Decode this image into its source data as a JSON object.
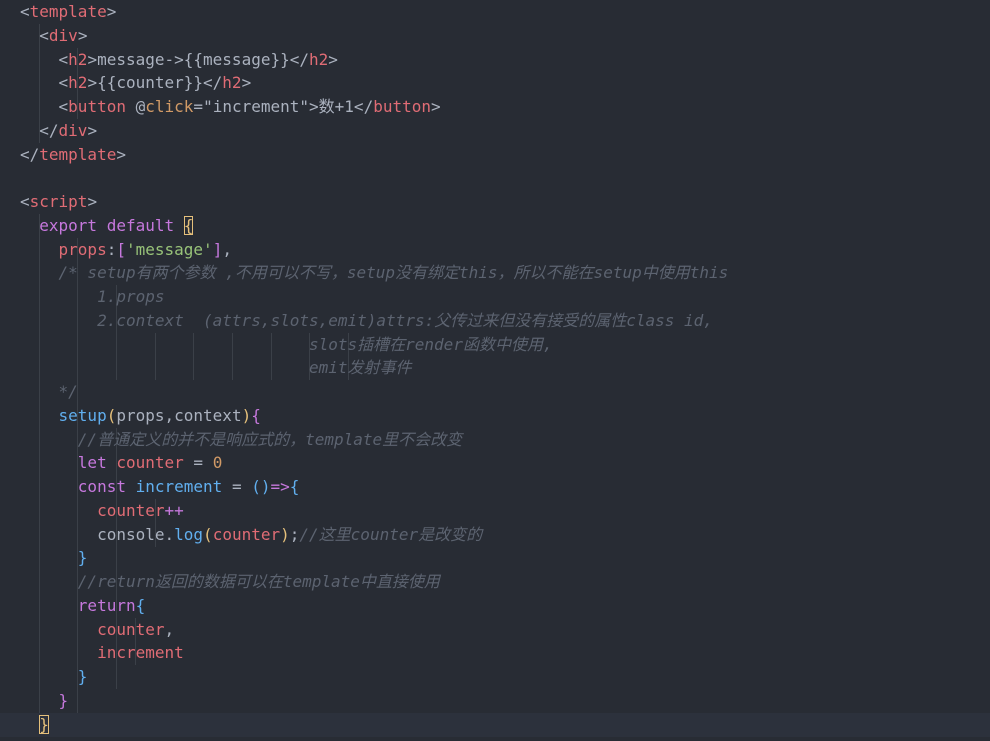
{
  "lines": [
    "<template>",
    "  <div>",
    "    <h2>message->{{message}}</h2>",
    "    <h2>{{counter}}</h2>",
    "    <button @click=\"increment\">数+1</button>",
    "  </div>",
    "</template>",
    "",
    "<script>",
    "  export default {",
    "    props:['message'],",
    "    /* setup有两个参数 ,不用可以不写，setup没有绑定this，所以不能在setup中使用this",
    "        1.props",
    "        2.context  (attrs,slots,emit)attrs:父传过来但没有接受的属性class id,",
    "                              slots插槽在render函数中使用,",
    "                              emit发射事件",
    "    */",
    "    setup(props,context){",
    "      //普通定义的并不是响应式的，template里不会改变",
    "      let counter = 0",
    "      const increment = ()=>{",
    "        counter++",
    "        console.log(counter);//这里counter是改变的",
    "      }",
    "      //return返回的数据可以在template中直接使用",
    "      return{",
    "        counter,",
    "        increment",
    "      }",
    "    }",
    "  }"
  ]
}
